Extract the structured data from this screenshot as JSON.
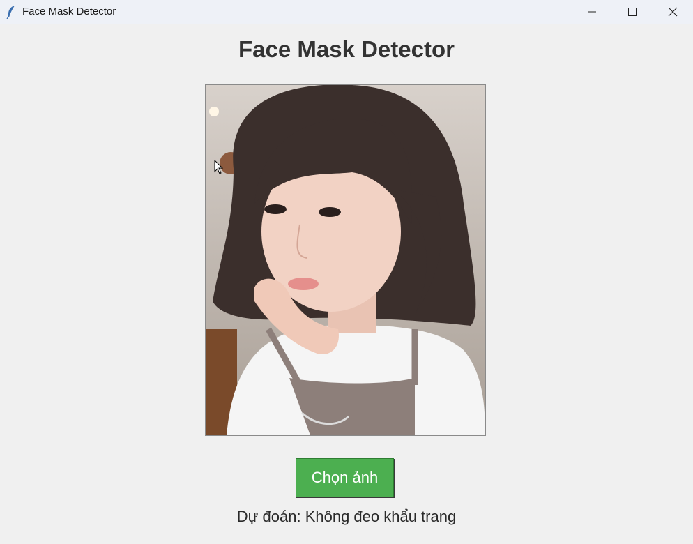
{
  "window": {
    "title": "Face Mask Detector",
    "icon": "feather-icon",
    "controls": [
      "minimize-icon",
      "maximize-icon",
      "close-icon"
    ]
  },
  "main": {
    "heading": "Face Mask Detector",
    "choose_button_label": "Chọn ảnh",
    "prediction_text": "Dự đoán: Không đeo khẩu trang"
  },
  "colors": {
    "button_bg": "#4caf50",
    "window_bg": "#f0f0f0"
  }
}
